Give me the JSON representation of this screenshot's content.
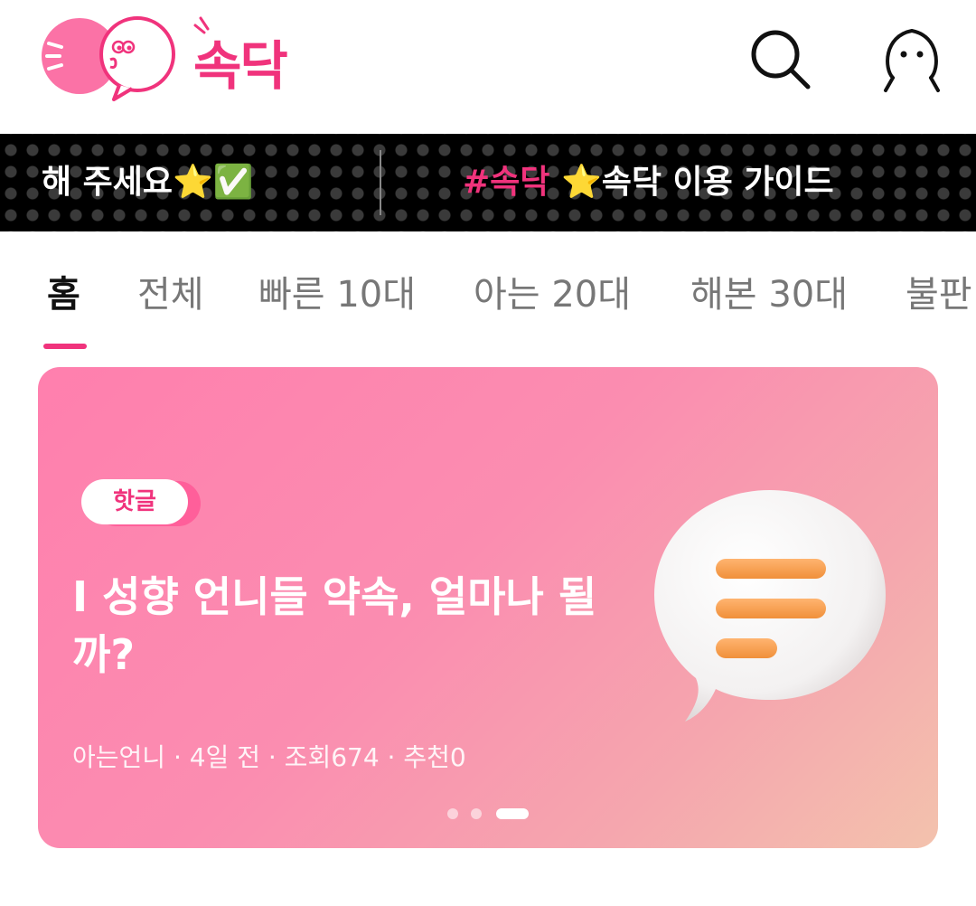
{
  "app": {
    "logo_text": "속닥",
    "search_icon": "search-icon",
    "profile_icon": "profile-icon",
    "brand_color": "#f0337c"
  },
  "ticker": {
    "left_text": "해 주세요⭐✅",
    "right_hash": "#속닥",
    "right_text": " ⭐속닥 이용 가이드"
  },
  "tabs": [
    {
      "label": "홈",
      "active": true
    },
    {
      "label": "전체"
    },
    {
      "label": "빠른 10대"
    },
    {
      "label": "아는 20대"
    },
    {
      "label": "해본 30대"
    },
    {
      "label": "불판"
    }
  ],
  "banner": {
    "tag": "핫글",
    "title": "I 성향 언니들 약속, 얼마나 될까?",
    "meta": "아는언니 · 4일 전 · 조회674 · 추천0",
    "icon": "chat-bubble-icon",
    "pagination": {
      "total": 3,
      "current": 3
    }
  }
}
